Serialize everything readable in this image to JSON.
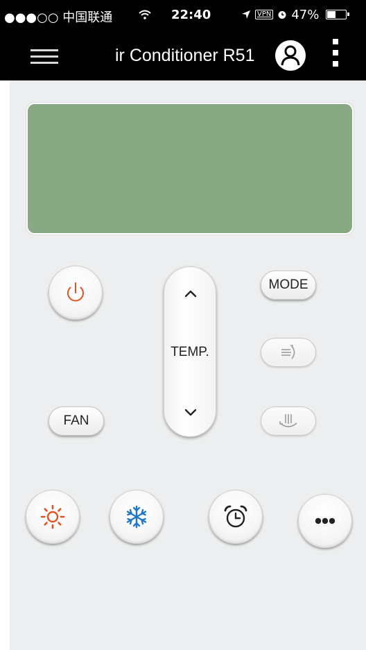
{
  "status_bar": {
    "carrier": "●●●○○ 中国联通 ",
    "wifi_icon": "wifi-icon",
    "time": "22:40",
    "vpn": "VPN",
    "battery_percent": "47%",
    "battery_level": 0.47
  },
  "nav": {
    "title": "ir Conditioner R51",
    "menu_icon": "hamburger-menu-icon",
    "user_icon": "user-icon",
    "more_icon": "more-vertical-icon"
  },
  "display": {
    "background": "#88a984"
  },
  "remote": {
    "mode_label": "MODE",
    "fan_label": "FAN",
    "temp_label": "TEMP.",
    "power_icon": "power-icon",
    "swing_horizontal_icon": "swing-horizontal-icon",
    "swing_vertical_icon": "swing-vertical-icon",
    "heat_icon": "sun-icon",
    "cool_icon": "snowflake-icon",
    "timer_icon": "alarm-clock-icon",
    "more_icon": "more-horizontal-icon"
  },
  "colors": {
    "accent_orange": "#e2511d",
    "cool_blue": "#1e78c8",
    "lcd_green": "#88a984",
    "panel_gray": "#eceeef"
  }
}
